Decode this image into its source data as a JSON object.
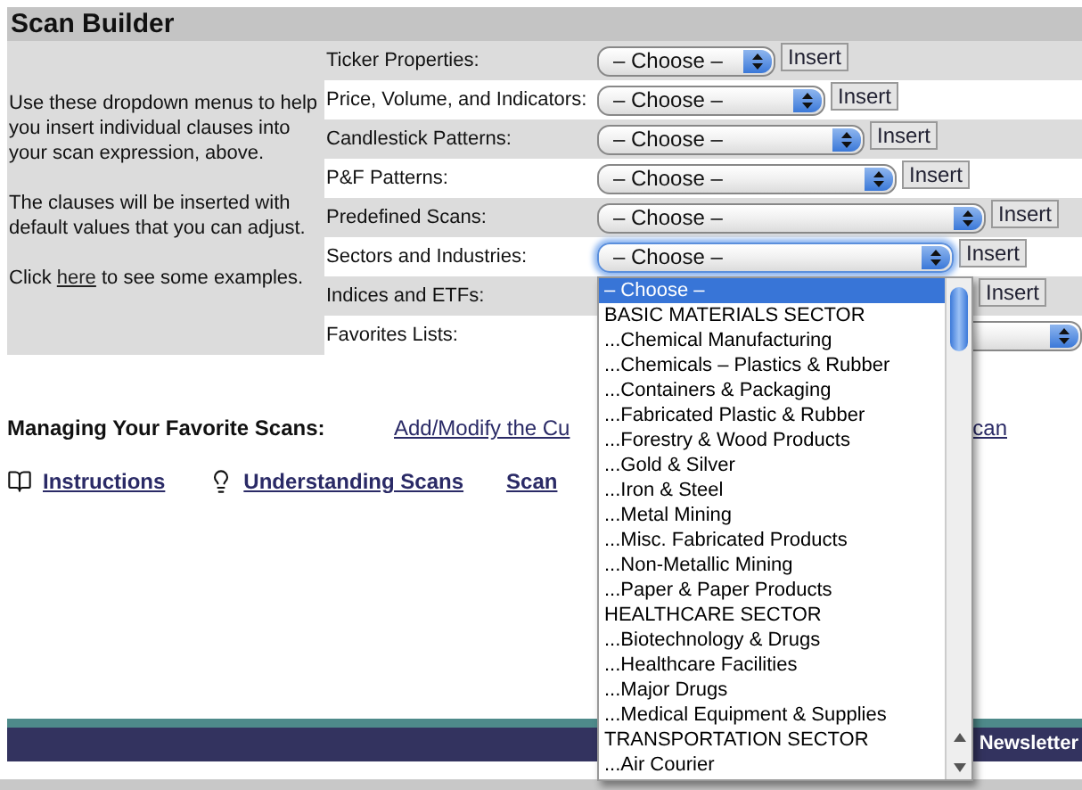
{
  "panel": {
    "title": "Scan Builder",
    "help": [
      "Use these dropdown menus to help you insert individual clauses into your scan expression, above.",
      "The clauses will be inserted with default values that you can adjust."
    ],
    "examples": {
      "before": "Click",
      "link": "here",
      "after": "to see some examples."
    },
    "rows": [
      {
        "label": "Ticker Properties:",
        "select": "– Choose –",
        "button": "Insert",
        "focused": false
      },
      {
        "label": "Price, Volume, and Indicators:",
        "select": "– Choose –",
        "button": "Insert",
        "focused": false
      },
      {
        "label": "Candlestick Patterns:",
        "select": "– Choose –",
        "button": "Insert",
        "focused": false
      },
      {
        "label": "P&F Patterns:",
        "select": "– Choose –",
        "button": "Insert",
        "focused": false
      },
      {
        "label": "Predefined Scans:",
        "select": "– Choose –",
        "button": "Insert",
        "focused": false
      },
      {
        "label": "Sectors and Industries:",
        "select": "– Choose –",
        "button": "Insert",
        "focused": true
      },
      {
        "label": "Indices and ETFs:",
        "button": "Insert",
        "kind": "button_only"
      },
      {
        "label": "Favorites Lists:",
        "focused": false
      }
    ]
  },
  "managing": {
    "label": "Managing Your Favorite Scans:",
    "link_start": "Add/Modify the Cu",
    "link_end": "can"
  },
  "links": [
    {
      "label": "Instructions",
      "kind": "book"
    },
    {
      "label": "Understanding Scans",
      "kind": "bulb"
    },
    {
      "label": "Scan",
      "kind": "none"
    }
  ],
  "dropdown": {
    "options": [
      {
        "label": "– Choose –",
        "selected": true
      },
      {
        "label": "BASIC MATERIALS SECTOR",
        "selected": false
      },
      {
        "label": "...Chemical Manufacturing",
        "selected": false
      },
      {
        "label": "...Chemicals – Plastics & Rubber",
        "selected": false
      },
      {
        "label": "...Containers & Packaging",
        "selected": false
      },
      {
        "label": "...Fabricated Plastic & Rubber",
        "selected": false
      },
      {
        "label": "...Forestry & Wood Products",
        "selected": false
      },
      {
        "label": "...Gold & Silver",
        "selected": false
      },
      {
        "label": "...Iron & Steel",
        "selected": false
      },
      {
        "label": "...Metal Mining",
        "selected": false
      },
      {
        "label": "...Misc. Fabricated Products",
        "selected": false
      },
      {
        "label": "...Non-Metallic Mining",
        "selected": false
      },
      {
        "label": "...Paper & Paper Products",
        "selected": false
      },
      {
        "label": "HEALTHCARE SECTOR",
        "selected": false
      },
      {
        "label": "...Biotechnology & Drugs",
        "selected": false
      },
      {
        "label": "...Healthcare Facilities",
        "selected": false
      },
      {
        "label": "...Major Drugs",
        "selected": false
      },
      {
        "label": "...Medical Equipment & Supplies",
        "selected": false
      },
      {
        "label": "TRANSPORTATION SECTOR",
        "selected": false
      },
      {
        "label": "...Air Courier",
        "selected": false
      }
    ]
  },
  "footer": {
    "link": "Newsletter"
  }
}
